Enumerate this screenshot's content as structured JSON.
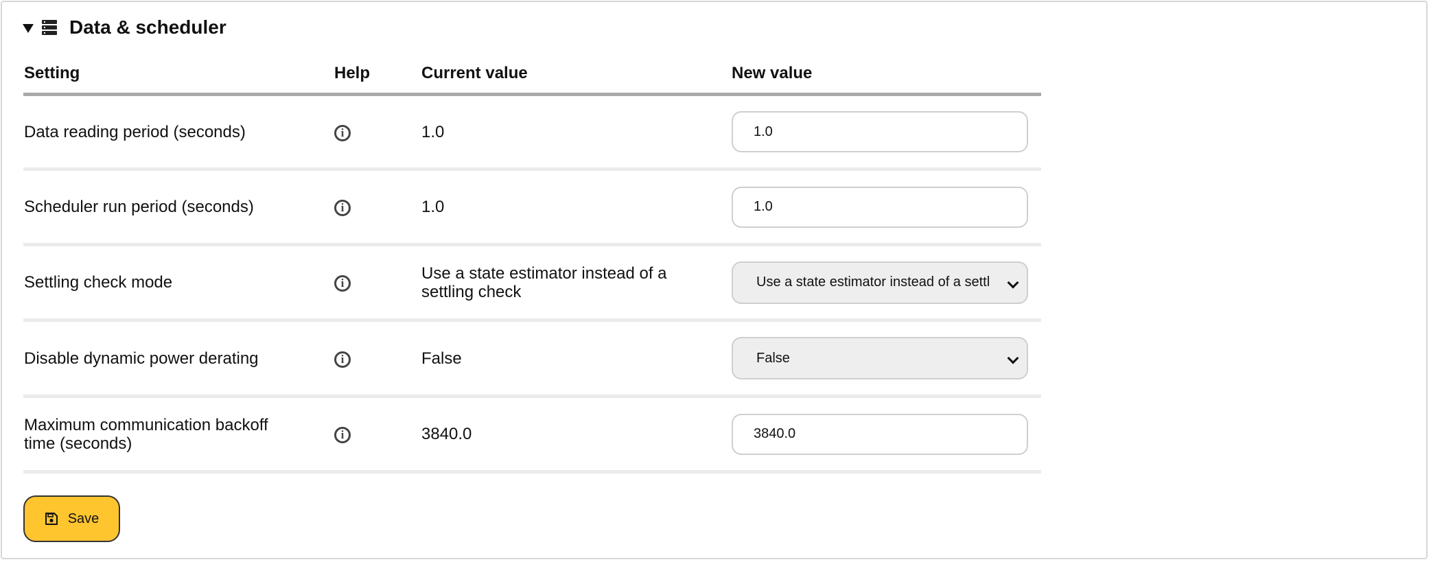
{
  "section": {
    "title": "Data & scheduler",
    "expanded": true,
    "caret_icon": "caret-down-icon",
    "icon": "database-icon"
  },
  "table": {
    "headers": {
      "setting": "Setting",
      "help": "Help",
      "current": "Current value",
      "new": "New value"
    },
    "rows": [
      {
        "name": "Data reading period (seconds)",
        "current": "1.0",
        "new_value": "1.0",
        "control": "input"
      },
      {
        "name": "Scheduler run period (seconds)",
        "current": "1.0",
        "new_value": "1.0",
        "control": "input"
      },
      {
        "name": "Settling check mode",
        "current": "Use a state estimator instead of a settling check",
        "new_value": "Use a state estimator instead of a settl",
        "control": "select"
      },
      {
        "name": "Disable dynamic power derating",
        "current": "False",
        "new_value": "False",
        "control": "select"
      },
      {
        "name": "Maximum communication backoff time (seconds)",
        "current": "3840.0",
        "new_value": "3840.0",
        "control": "input"
      }
    ],
    "help_icon": "info-icon"
  },
  "save_button": {
    "label": "Save",
    "icon": "save-icon",
    "color": "#ffc52f"
  }
}
